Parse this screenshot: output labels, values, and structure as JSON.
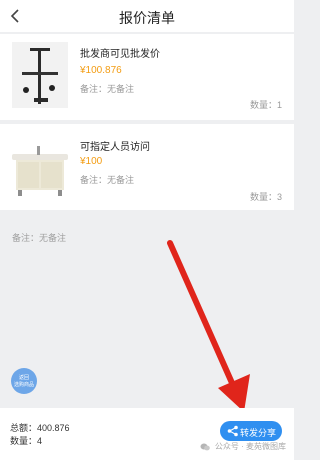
{
  "header": {
    "title": "报价清单"
  },
  "items": [
    {
      "name": "批发商可见批发价",
      "price": "¥100.876",
      "remark": "备注：无备注",
      "quantity": "数量：1"
    },
    {
      "name": "可指定人员访问",
      "price": "¥100",
      "remark": "备注：无备注",
      "quantity": "数量：3"
    }
  ],
  "order_remark": "备注：无备注",
  "float_badge": {
    "line1": "返回",
    "line2": "选购商品"
  },
  "footer": {
    "total": "总额：400.876",
    "count": "数量：4",
    "share_label": "转发分享"
  },
  "watermark": "公众号 · 麦苑微图库",
  "colors": {
    "price": "#f39c12",
    "share_button": "#2f8ff0",
    "arrow": "#e0251b",
    "badge": "#6da6e8"
  },
  "icons": {
    "back": "chevron-left-icon",
    "share": "share-icon",
    "watermark": "wechat-icon"
  }
}
